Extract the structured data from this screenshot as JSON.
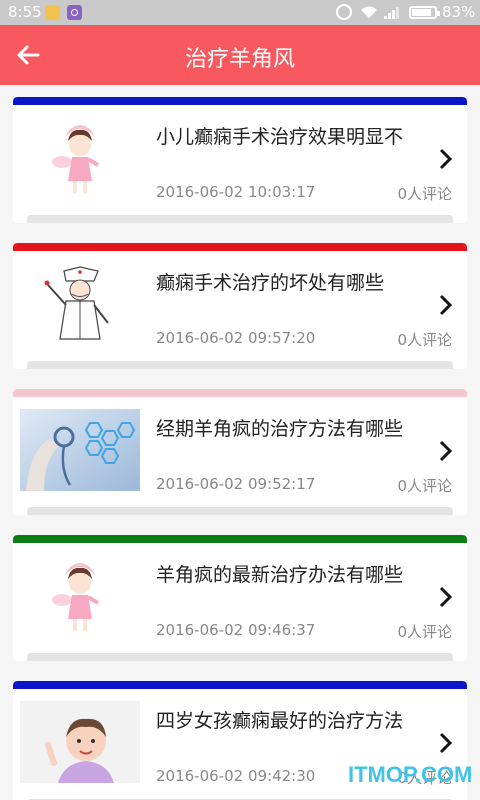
{
  "status_bar": {
    "time": "8:55",
    "battery": "83%",
    "icons": [
      "app-notification-icon",
      "app-notification-icon",
      "alarm-icon",
      "wifi-icon",
      "signal-icon",
      "battery-icon"
    ]
  },
  "app_bar": {
    "title": "治疗羊角风",
    "back_icon": "arrow-left-icon"
  },
  "articles": [
    {
      "title": "小儿癫痫手术治疗效果明显不",
      "date": "2016-06-02 10:03:17",
      "comments": "0人评论",
      "accent": "#0b17c9",
      "thumb": "nurse"
    },
    {
      "title": "癫痫手术治疗的坏处有哪些",
      "date": "2016-06-02 09:57:20",
      "comments": "0人评论",
      "accent": "#e4151b",
      "thumb": "doctor"
    },
    {
      "title": "经期羊角疯的治疗方法有哪些",
      "date": "2016-06-02 09:52:17",
      "comments": "0人评论",
      "accent": "#f4c5cc",
      "thumb": "medical"
    },
    {
      "title": "羊角疯的最新治疗办法有哪些",
      "date": "2016-06-02 09:46:37",
      "comments": "0人评论",
      "accent": "#0b7d12",
      "thumb": "nurse"
    },
    {
      "title": "四岁女孩癫痫最好的治疗方法",
      "date": "2016-06-02 09:42:30",
      "comments": "0人评论",
      "accent": "#0b17c9",
      "thumb": "child"
    }
  ],
  "watermark": "ITMOP.COM"
}
